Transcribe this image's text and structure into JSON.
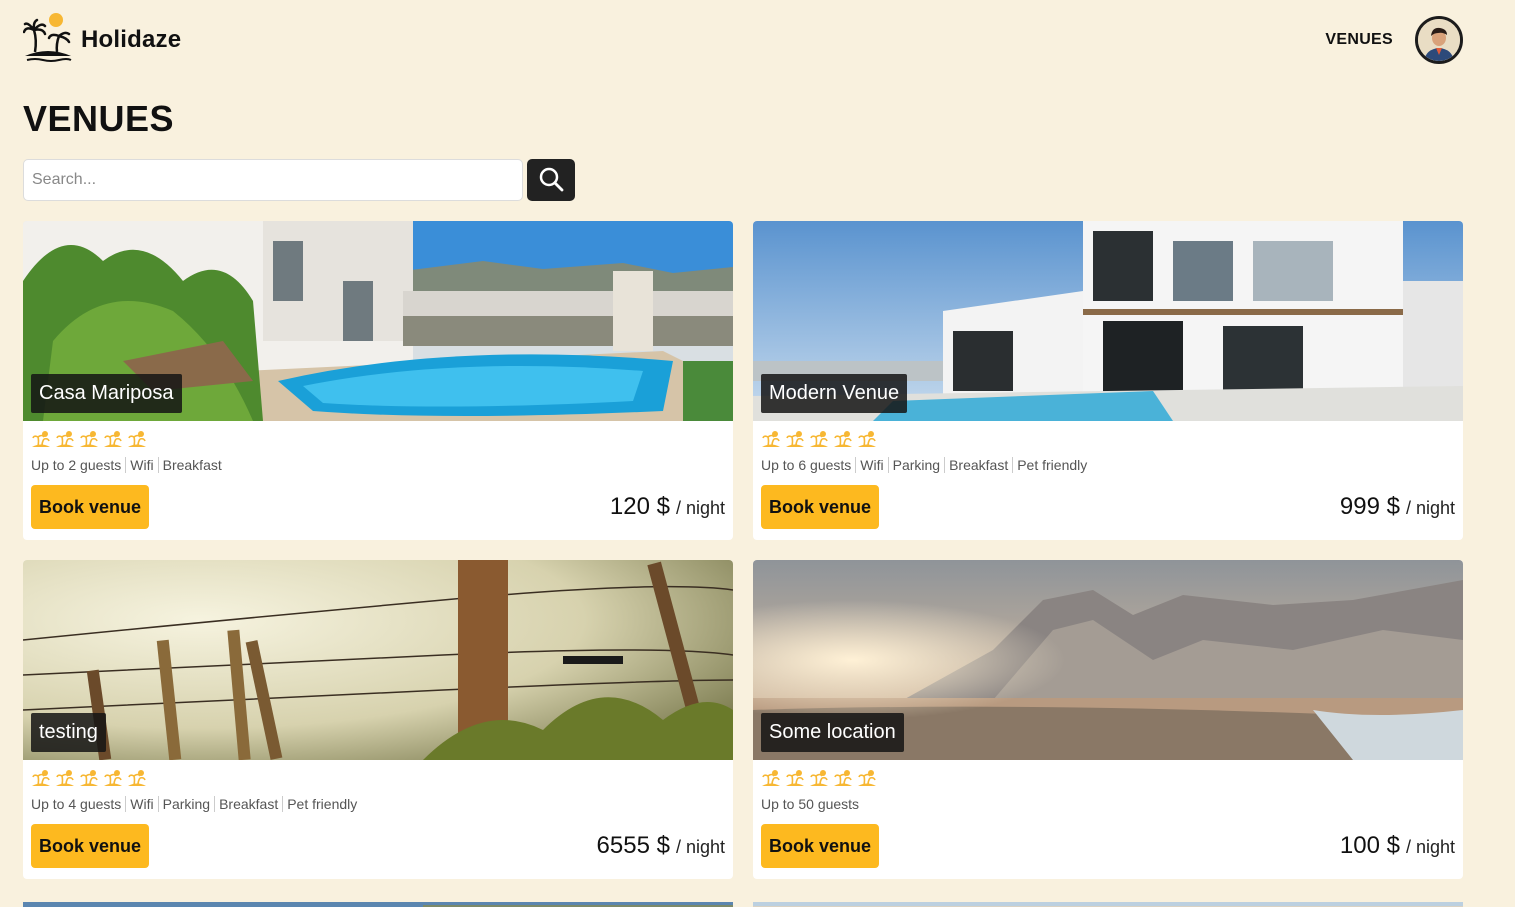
{
  "brand": {
    "name": "Holidaze",
    "logo_icon": "palm-island-sun-icon"
  },
  "nav": {
    "venues_label": "VENUES",
    "avatar_icon": "user-avatar"
  },
  "page": {
    "title": "VENUES"
  },
  "search": {
    "placeholder": "Search...",
    "button_icon": "search-icon"
  },
  "venues": [
    {
      "name": "Casa Mariposa",
      "rating": 5,
      "guests": "Up to 2 guests",
      "features": [
        "Wifi",
        "Breakfast"
      ],
      "price": "120 $",
      "unit": "/ night",
      "book_label": "Book venue"
    },
    {
      "name": "Modern Venue",
      "rating": 5,
      "guests": "Up to 6 guests",
      "features": [
        "Wifi",
        "Parking",
        "Breakfast",
        "Pet friendly"
      ],
      "price": "999 $",
      "unit": "/ night",
      "book_label": "Book venue"
    },
    {
      "name": "testing",
      "rating": 5,
      "guests": "Up to 4 guests",
      "features": [
        "Wifi",
        "Parking",
        "Breakfast",
        "Pet friendly"
      ],
      "price": "6555 $",
      "unit": "/ night",
      "book_label": "Book venue"
    },
    {
      "name": "Some location",
      "rating": 5,
      "guests": "Up to 50 guests",
      "features": [],
      "price": "100 $",
      "unit": "/ night",
      "book_label": "Book venue"
    }
  ],
  "colors": {
    "background": "#f9f1de",
    "accent": "#fdb91f",
    "dark": "#222222",
    "rating_icon": "#f7b733"
  }
}
